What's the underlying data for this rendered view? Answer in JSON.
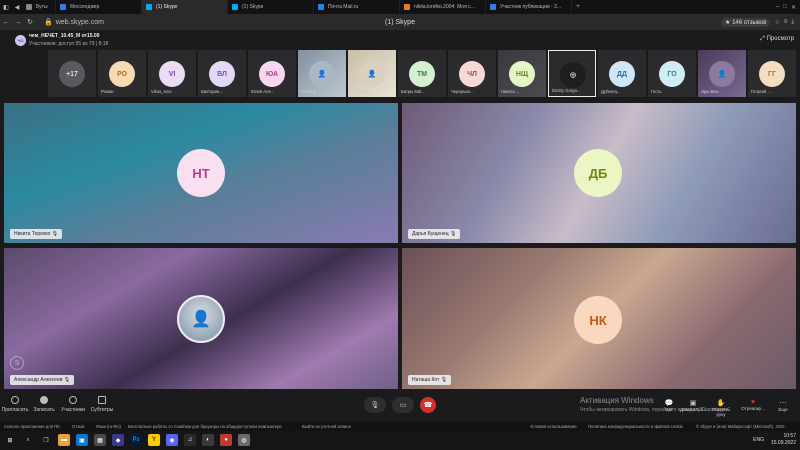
{
  "tabs": [
    {
      "label": "Буты",
      "color": "#888888"
    },
    {
      "label": "Мессенджер",
      "color": "#2e7ef0"
    },
    {
      "label": "(1) Skype",
      "color": "#00aff0",
      "active": true
    },
    {
      "label": "(1) Skype",
      "color": "#00aff0"
    },
    {
      "label": "Почта Mail.ru",
      "color": "#1e88e5"
    },
    {
      "label": "nikita.lorelko.2004: Моя с...",
      "color": "#e67e22"
    },
    {
      "label": "Участник публикации - 2...",
      "color": "#2e7ef0"
    }
  ],
  "address": {
    "url": "web.skype.com",
    "window_title": "(1) Skype",
    "reviews": "★ 146 отзывов"
  },
  "call": {
    "avatar": "ЧО",
    "name": "чем_НЕЧЕТ_10.45_М от15.09",
    "subtitle": "Участников: доступ 55 из 79 | 8:18",
    "preview": "Просмотр"
  },
  "participants": [
    {
      "initials": "+17",
      "name": "",
      "bg": "#5a5a5e",
      "fg": "#dddddd"
    },
    {
      "initials": "РО",
      "name": "Роман",
      "bg": "#f7d9b2",
      "fg": "#c06a1a"
    },
    {
      "initials": "VI",
      "name": "Vikus_smo",
      "bg": "#eadcf3",
      "fg": "#8a3ac0"
    },
    {
      "initials": "ВЛ",
      "name": "Викторин...",
      "bg": "#e3d8f6",
      "fg": "#7a48c8"
    },
    {
      "initials": "ЮА",
      "name": "Юлия Але...",
      "bg": "#f6d7ee",
      "fg": "#b03a90"
    },
    {
      "initials": "",
      "name": "Георгий ...",
      "bg": "#a9b8c4",
      "fg": "#333333"
    },
    {
      "initials": "",
      "name": "Lusik Ma...",
      "bg": "#d9d0c0",
      "fg": "#333333"
    },
    {
      "initials": "ТМ",
      "name": "Батры Мal...",
      "bg": "#d5f0d0",
      "fg": "#2e8a2a"
    },
    {
      "initials": "ЧЛ",
      "name": "Чeрepuae...",
      "bg": "#f6d8d6",
      "fg": "#b04040"
    },
    {
      "initials": "НЩ",
      "name": "Никита ...",
      "bg": "#e6f5c6",
      "fg": "#5a8a10"
    },
    {
      "initials": "",
      "name": "Dmitry Gorgo...",
      "bg": "#1e1e1e",
      "fg": "#dddddd"
    },
    {
      "initials": "ДД",
      "name": "Дубинчу...",
      "bg": "#cfe6f8",
      "fg": "#2470b0"
    },
    {
      "initials": "ГО",
      "name": "Гость",
      "bg": "#d0ecf5",
      "fg": "#2283a8"
    },
    {
      "initials": "",
      "name": "Иры Вин...",
      "bg": "#8a7aa0",
      "fg": "#dddddd"
    },
    {
      "initials": "ГГ",
      "name": "Георгий ...",
      "bg": "#f5ddc0",
      "fg": "#b0702a"
    }
  ],
  "tiles": [
    {
      "initials": "НТ",
      "name": "Никита Терехко",
      "bg": "#f9e0ef",
      "fg": "#c03a92"
    },
    {
      "initials": "ДБ",
      "name": "Дарья Бущенец",
      "bg": "#ecf5c4",
      "fg": "#6a8a10"
    },
    {
      "initials": "",
      "name": "Александр Алексеев",
      "bg": "#c0c8d0",
      "fg": "#333333"
    },
    {
      "initials": "НК",
      "name": "Наташа Кот",
      "bg": "#fad8c0",
      "fg": "#c05a10"
    }
  ],
  "controls": {
    "left": [
      "Пригласить",
      "Записать",
      "Участники",
      "Субтитры"
    ],
    "right": [
      "Чат",
      "Демонстрa...",
      "Поднять руку",
      "Отреагир...",
      "Еще"
    ]
  },
  "activation": {
    "title": "Активация Windows",
    "subtitle": "Чтобы активировать Windows, перейдите в раздел \"Парамeтры\"."
  },
  "infobar": {
    "items": [
      "Скачать приложение для ПК",
      "Отзыв",
      "Язык (ru-RU)",
      "Бесплатные работы со Скайпом для браузеры на общедоступном компьютере",
      "Выйти из учетной записи"
    ],
    "right_items": [
      "Условия использования",
      "Политика конфиденциальности и файлов cookie",
      "© Skype и (или) Майкрософт (Microsoft), 2022."
    ]
  },
  "taskbar": {
    "lang": "ENG",
    "time": "10:57",
    "date": "15.09.2022"
  }
}
